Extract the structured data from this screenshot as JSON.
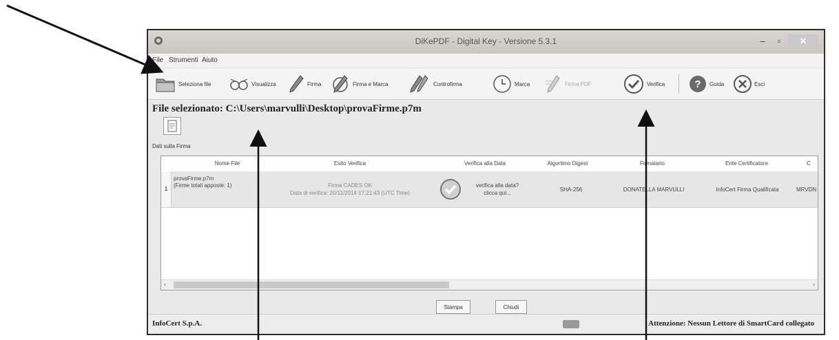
{
  "window": {
    "title": "DiKePDF - Digital Key - Versione 5.3.1"
  },
  "menu": [
    "File",
    "Strumenti",
    "Aiuto"
  ],
  "toolbar": {
    "seleziona_file": "Seleziona file",
    "visualizza": "Visualizza",
    "firma": "Firma",
    "firma_e_marca": "Firma e Marca",
    "controfirma": "Controfirma",
    "marca": "Marca",
    "firma_pdf": "Firma PDF",
    "verifica": "Verifica",
    "guida": "Guida",
    "esci": "Esci"
  },
  "file_selezionato": "File selezionato: C:\\Users\\marvulli\\Desktop\\provaFirme.p7m",
  "section_label": "Dati sulla Firma",
  "table": {
    "columns": [
      "Nome File",
      "Esito Verifica",
      "Verifica alla Data",
      "Algoritmo Digest",
      "Firmatario",
      "Ente Certificatore",
      "C"
    ],
    "rows": [
      {
        "num": "1",
        "nome_file_line1": "provaFirme.p7m",
        "nome_file_line2": "(Firme totali apposte: 1)",
        "esito_line1": "Firma CADES OK",
        "esito_line2": "Data di verifica: 20/11/2014 17:21:43 (UTC Time)",
        "verifica_line1": "verifica alla data?",
        "verifica_line2": "clicca qui...",
        "algoritmo": "SHA-256",
        "firmatario": "DONATELLA MARVULLI",
        "ente": "InfoCert Firma Qualificata",
        "c": "MRVDN"
      }
    ]
  },
  "buttons": {
    "stampa": "Stampa",
    "chiudi": "Chiudi"
  },
  "status": {
    "company": "InfoCert S.p.A.",
    "message": "Attenzione: Nessun Lettore di SmartCard collegato"
  },
  "icons": [
    "folder-icon",
    "glasses-icon",
    "pen-icon",
    "pen-clock-icon",
    "countersign-pen-icon",
    "clock-icon",
    "pdf-pen-icon",
    "check-icon",
    "help-icon",
    "exit-icon",
    "checkmark-badge-icon",
    "card-reader-icon"
  ]
}
